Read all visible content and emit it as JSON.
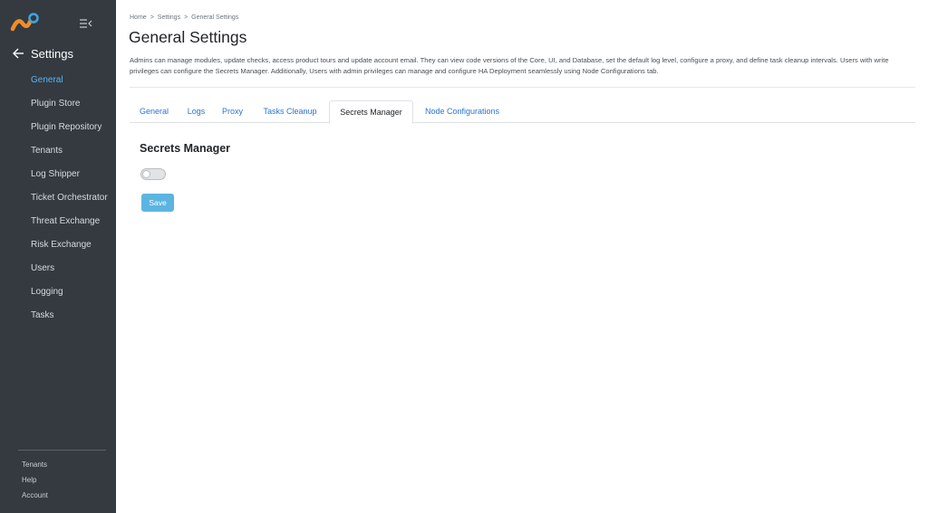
{
  "colors": {
    "sidebar_bg": "#343a40",
    "active_nav": "#5ab3f0",
    "tab_link": "#2b73d6",
    "save_button": "#5bb5e0",
    "logo_orange": "#f28c28",
    "logo_blue": "#3ea6e0"
  },
  "sidebar": {
    "logo_icon": "app-logo-icon",
    "collapse_icon": "collapse-sidebar-icon",
    "back_icon": "arrow-left-icon",
    "back_label": "Settings",
    "items": [
      {
        "label": "General"
      },
      {
        "label": "Plugin Store"
      },
      {
        "label": "Plugin Repository"
      },
      {
        "label": "Tenants"
      },
      {
        "label": "Log Shipper"
      },
      {
        "label": "Ticket Orchestrator"
      },
      {
        "label": "Threat Exchange"
      },
      {
        "label": "Risk Exchange"
      },
      {
        "label": "Users"
      },
      {
        "label": "Logging"
      },
      {
        "label": "Tasks"
      }
    ],
    "active_item": "General",
    "footer": [
      {
        "label": "Tenants"
      },
      {
        "label": "Help"
      },
      {
        "label": "Account"
      }
    ]
  },
  "breadcrumb": {
    "items": [
      "Home",
      "Settings",
      "General Settings"
    ],
    "separator": ">"
  },
  "header": {
    "title": "General Settings",
    "description": "Admins can manage modules, update checks, access product tours and update account email. They can view code versions of the Core, UI, and Database, set the default log level, configure a proxy, and define task cleanup intervals. Users with write privileges can configure the Secrets Manager. Additionally, Users with admin privileges can manage and configure HA Deployment seamlessly using Node Configurations tab."
  },
  "tabs": [
    {
      "label": "General"
    },
    {
      "label": "Logs"
    },
    {
      "label": "Proxy"
    },
    {
      "label": "Tasks Cleanup"
    },
    {
      "label": "Secrets Manager"
    },
    {
      "label": "Node Configurations"
    }
  ],
  "active_tab": "Secrets Manager",
  "panel": {
    "title": "Secrets Manager",
    "toggle_enabled": false,
    "save_label": "Save"
  }
}
